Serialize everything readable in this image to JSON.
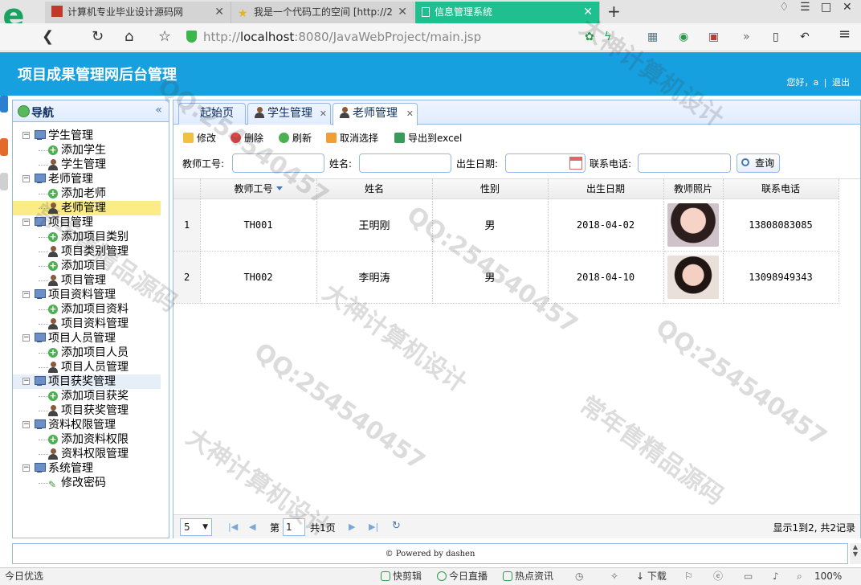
{
  "browser": {
    "tabs": [
      {
        "title": "计算机专业毕业设计源码网"
      },
      {
        "title": "我是一个代码工的空间 [http://2"
      },
      {
        "title": "信息管理系统"
      }
    ],
    "url_host": "localhost",
    "url_rest": ":8080/JavaWebProject/main.jsp",
    "url_scheme": "http://"
  },
  "app": {
    "title": "项目成果管理网后台管理",
    "greeting": "您好，a",
    "separator": "|",
    "logout": "退出"
  },
  "sidebar": {
    "title": "导航",
    "collapse": "«",
    "groups": [
      {
        "label": "学生管理",
        "children": [
          {
            "label": "添加学生",
            "icon": "add"
          },
          {
            "label": "学生管理",
            "icon": "user"
          }
        ]
      },
      {
        "label": "老师管理",
        "children": [
          {
            "label": "添加老师",
            "icon": "add"
          },
          {
            "label": "老师管理",
            "icon": "user"
          }
        ]
      },
      {
        "label": "项目管理",
        "children": [
          {
            "label": "添加项目类别",
            "icon": "add"
          },
          {
            "label": "项目类别管理",
            "icon": "user"
          },
          {
            "label": "添加项目",
            "icon": "add"
          },
          {
            "label": "项目管理",
            "icon": "user"
          }
        ]
      },
      {
        "label": "项目资料管理",
        "children": [
          {
            "label": "添加项目资料",
            "icon": "add"
          },
          {
            "label": "项目资料管理",
            "icon": "user"
          }
        ]
      },
      {
        "label": "项目人员管理",
        "children": [
          {
            "label": "添加项目人员",
            "icon": "add"
          },
          {
            "label": "项目人员管理",
            "icon": "user"
          }
        ]
      },
      {
        "label": "项目获奖管理",
        "children": [
          {
            "label": "添加项目获奖",
            "icon": "add"
          },
          {
            "label": "项目获奖管理",
            "icon": "user"
          }
        ]
      },
      {
        "label": "资料权限管理",
        "children": [
          {
            "label": "添加资料权限",
            "icon": "add"
          },
          {
            "label": "资料权限管理",
            "icon": "user"
          }
        ]
      },
      {
        "label": "系统管理",
        "children": [
          {
            "label": "修改密码",
            "icon": "pencil"
          }
        ]
      }
    ]
  },
  "main": {
    "tabs": [
      {
        "label": "起始页"
      },
      {
        "label": "学生管理"
      },
      {
        "label": "老师管理"
      }
    ],
    "toolbar": {
      "edit": "修改",
      "delete": "删除",
      "refresh": "刷新",
      "unselect": "取消选择",
      "export": "导出到excel"
    },
    "search": {
      "teacher_no_label": "教师工号:",
      "name_label": "姓名:",
      "birth_label": "出生日期:",
      "phone_label": "联系电话:",
      "button": "查询"
    },
    "grid": {
      "columns": [
        "教师工号",
        "姓名",
        "性别",
        "出生日期",
        "教师照片",
        "联系电话"
      ],
      "rows": [
        {
          "rn": "1",
          "no": "TH001",
          "name": "王明刚",
          "sex": "男",
          "birth": "2018-04-02",
          "phone": "13808083085"
        },
        {
          "rn": "2",
          "no": "TH002",
          "name": "李明涛",
          "sex": "男",
          "birth": "2018-04-10",
          "phone": "13098949343"
        }
      ]
    },
    "pager": {
      "page_size": "5",
      "page_prefix": "第",
      "page": "1",
      "page_total": "共1页",
      "summary": "显示1到2, 共2记录"
    }
  },
  "footer": "© Powered by dashen",
  "statusbar": {
    "left": "今日优选",
    "items": [
      "快剪辑",
      "今日直播",
      "热点资讯"
    ],
    "download": "下载",
    "zoom": "100%"
  },
  "watermark": [
    "QQ:254540457",
    "大神计算机设计",
    "常年售精品源码"
  ]
}
